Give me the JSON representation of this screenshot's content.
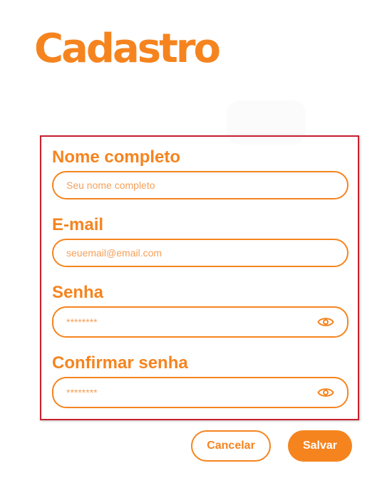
{
  "page": {
    "title": "Cadastro"
  },
  "form": {
    "name": {
      "label": "Nome completo",
      "placeholder": "Seu nome completo"
    },
    "email": {
      "label": "E-mail",
      "placeholder": "seuemail@email.com"
    },
    "password": {
      "label": "Senha",
      "placeholder": "********",
      "icon": "eye-icon"
    },
    "confirm_password": {
      "label": "Confirmar senha",
      "placeholder": "********",
      "icon": "eye-icon"
    }
  },
  "actions": {
    "cancel_label": "Cancelar",
    "save_label": "Salvar"
  },
  "colors": {
    "accent": "#f5841f",
    "panel_border": "#c8202f",
    "background": "#ffffff"
  }
}
